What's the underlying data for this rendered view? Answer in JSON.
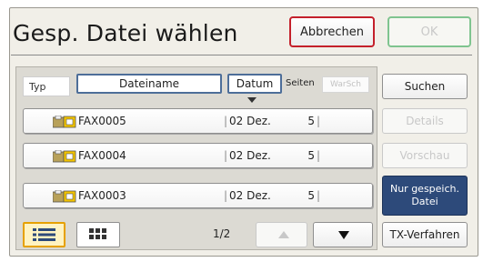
{
  "dialog": {
    "title": "Gesp. Datei wählen"
  },
  "buttons": {
    "cancel": "Abbrechen",
    "ok": "OK"
  },
  "columns": {
    "typ": "Typ",
    "dateiname": "Dateiname",
    "datum": "Datum",
    "seiten": "Seiten",
    "warsch": "WarSch"
  },
  "files": [
    {
      "name": "FAX0005",
      "date": "02 Dez.",
      "pages": "5"
    },
    {
      "name": "FAX0004",
      "date": "02 Dez.",
      "pages": "5"
    },
    {
      "name": "FAX0003",
      "date": "02 Dez.",
      "pages": "5"
    }
  ],
  "side": {
    "suchen": "Suchen",
    "details": "Details",
    "vorschau": "Vorschau",
    "nur_line1": "Nur gespeich.",
    "nur_line2": "Datei",
    "tx": "TX-Verfahren"
  },
  "pagination": {
    "indicator": "1/2"
  },
  "colors": {
    "cancel_border": "#c4202b",
    "ok_border": "#7fc48f",
    "selected": "#2d4a7a",
    "view_active": "#e6a100"
  },
  "icons": [
    "fax-file-icon",
    "list-view-icon",
    "grid-view-icon",
    "arrow-up-icon",
    "arrow-down-icon"
  ]
}
